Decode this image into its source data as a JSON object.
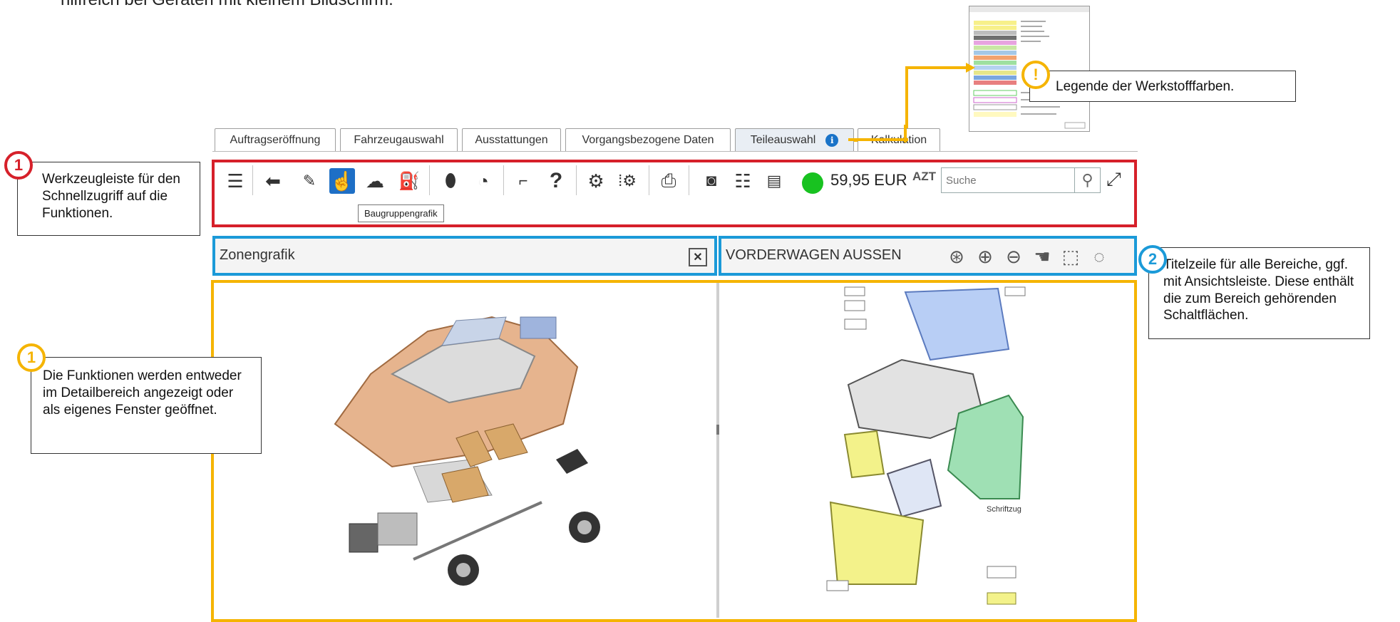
{
  "intro_text": "hilfreich bei Geräten mit kleinem Bildschirm.",
  "tabs": [
    {
      "label": "Auftragseröffnung"
    },
    {
      "label": "Fahrzeugauswahl"
    },
    {
      "label": "Ausstattungen"
    },
    {
      "label": "Vorgangsbezogene Daten"
    },
    {
      "label": "Teileauswahl"
    },
    {
      "label": "Kalkulation"
    }
  ],
  "toolbar": {
    "price": "59,95 EUR",
    "azt_label": "AZT",
    "search_placeholder": "Suche",
    "tooltip": "Baugruppengrafik",
    "status_color": "#18c220"
  },
  "panels": {
    "left_title": "Zonengrafik",
    "right_title": "VORDERWAGEN AUSSEN",
    "right_label_schriftzug": "Schriftzug"
  },
  "callouts": {
    "toolbar": {
      "badge": "1",
      "text": "Werkzeugleiste für den Schnellzugriff auf die Funktionen."
    },
    "functions": {
      "badge": "1",
      "text": "Die Funktionen werden entweder im Detailbereich angezeigt oder als eigenes Fenster geöffnet."
    },
    "titlebar": {
      "badge": "2",
      "text": "Titelzeile für alle Bereiche, ggf. mit Ansichtsleiste. Diese enthält die zum Bereich gehörenden Schaltflächen."
    },
    "legend": {
      "badge": "!",
      "text": "Legende der Werkstofffarben."
    }
  },
  "colors": {
    "red": "#d6202a",
    "blue": "#1b9ad8",
    "yellow": "#f5b400"
  }
}
